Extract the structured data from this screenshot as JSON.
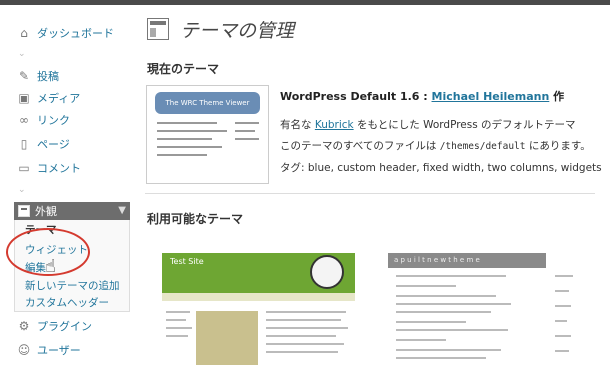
{
  "sidebar": {
    "items": [
      {
        "label": "ダッシュボード",
        "icon": "home-icon"
      },
      {
        "label": "投稿",
        "icon": "pin-icon"
      },
      {
        "label": "メディア",
        "icon": "media-icon"
      },
      {
        "label": "リンク",
        "icon": "link-icon"
      },
      {
        "label": "ページ",
        "icon": "page-icon"
      },
      {
        "label": "コメント",
        "icon": "comment-icon"
      }
    ],
    "appearance": {
      "label": "外観"
    },
    "submenu": [
      "テーマ",
      "ウィジェット",
      "編集",
      "新しいテーマの追加",
      "カスタムヘッダー"
    ],
    "bottom_items": [
      {
        "label": "プラグイン",
        "icon": "plugin-icon"
      },
      {
        "label": "ユーザー",
        "icon": "users-icon"
      }
    ]
  },
  "main": {
    "title": "テーマの管理",
    "current_heading": "現在のテーマ",
    "current_theme": {
      "name": "WordPress Default 1.6 : ",
      "author": "Michael Heilemann",
      "author_suffix": " 作",
      "thumb_header": "The WRC Theme Viewer",
      "desc_prefix": "有名な ",
      "desc_link": "Kubrick",
      "desc_suffix": " をもとにした WordPress のデフォルトテーマ",
      "path_prefix": "このテーマのすべてのファイルは ",
      "path": "/themes/default",
      "path_suffix": " にあります。",
      "tags": "タグ: blue, custom header, fixed width, two columns, widgets"
    },
    "available_heading": "利用可能なテーマ",
    "available_themes": [
      {
        "thumb_title": "Test Site"
      },
      {
        "thumb_title": "a p u i l t   n e w   t h e m e"
      }
    ]
  }
}
